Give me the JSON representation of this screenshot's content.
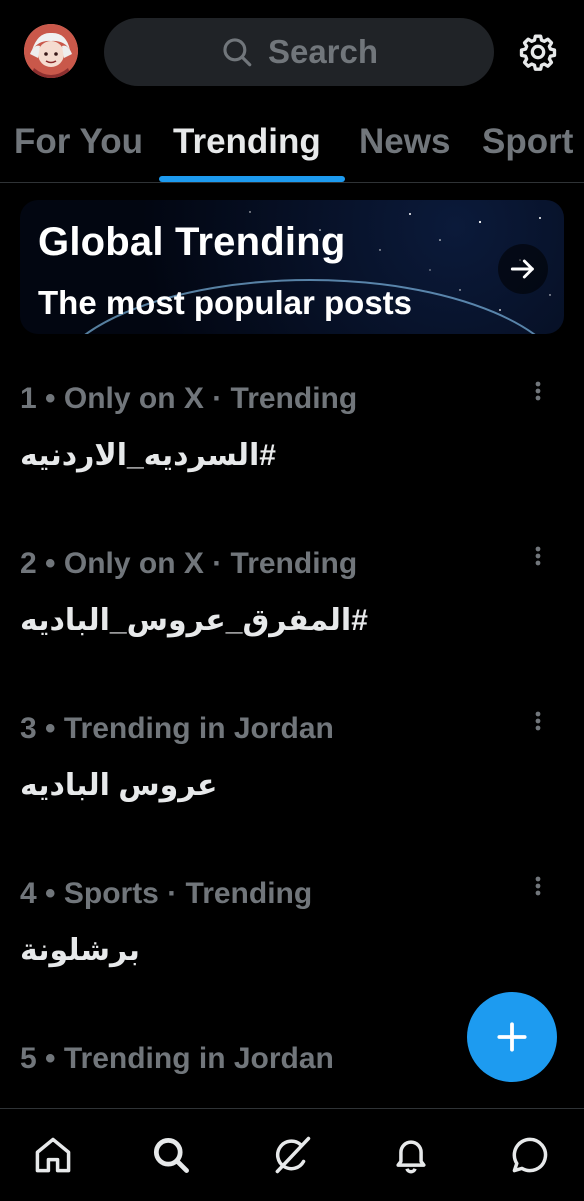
{
  "header": {
    "search_placeholder": "Search"
  },
  "tabs": [
    {
      "label": "For You",
      "active": false
    },
    {
      "label": "Trending",
      "active": true
    },
    {
      "label": "News",
      "active": false
    },
    {
      "label": "Sport",
      "active": false
    }
  ],
  "banner": {
    "title": "Global Trending",
    "subtitle": "The most popular posts"
  },
  "trends": [
    {
      "meta": "1 • Only on X · Trending",
      "name": "#السرديه_الاردنيه"
    },
    {
      "meta": "2 • Only on X · Trending",
      "name": "#المفرق_عروس_الباديه"
    },
    {
      "meta": "3 • Trending in Jordan",
      "name": "عروس الباديه"
    },
    {
      "meta": "4 • Sports · Trending",
      "name": "برشلونة"
    },
    {
      "meta": "5 • Trending in Jordan",
      "name": ""
    }
  ],
  "icons": {
    "avatar": "avatar-image",
    "search": "search-icon",
    "settings": "gear-icon",
    "banner_arrow": "arrow-right-icon",
    "more": "more-vertical-icon",
    "compose": "plus-icon",
    "nav": [
      "home-icon",
      "search-icon",
      "grok-icon",
      "bell-icon",
      "messages-icon"
    ]
  },
  "colors": {
    "background": "#000000",
    "accent": "#1d9bf0",
    "primary_text": "#e7e9ea",
    "secondary_text": "#71767b",
    "divider": "#2f3336"
  }
}
